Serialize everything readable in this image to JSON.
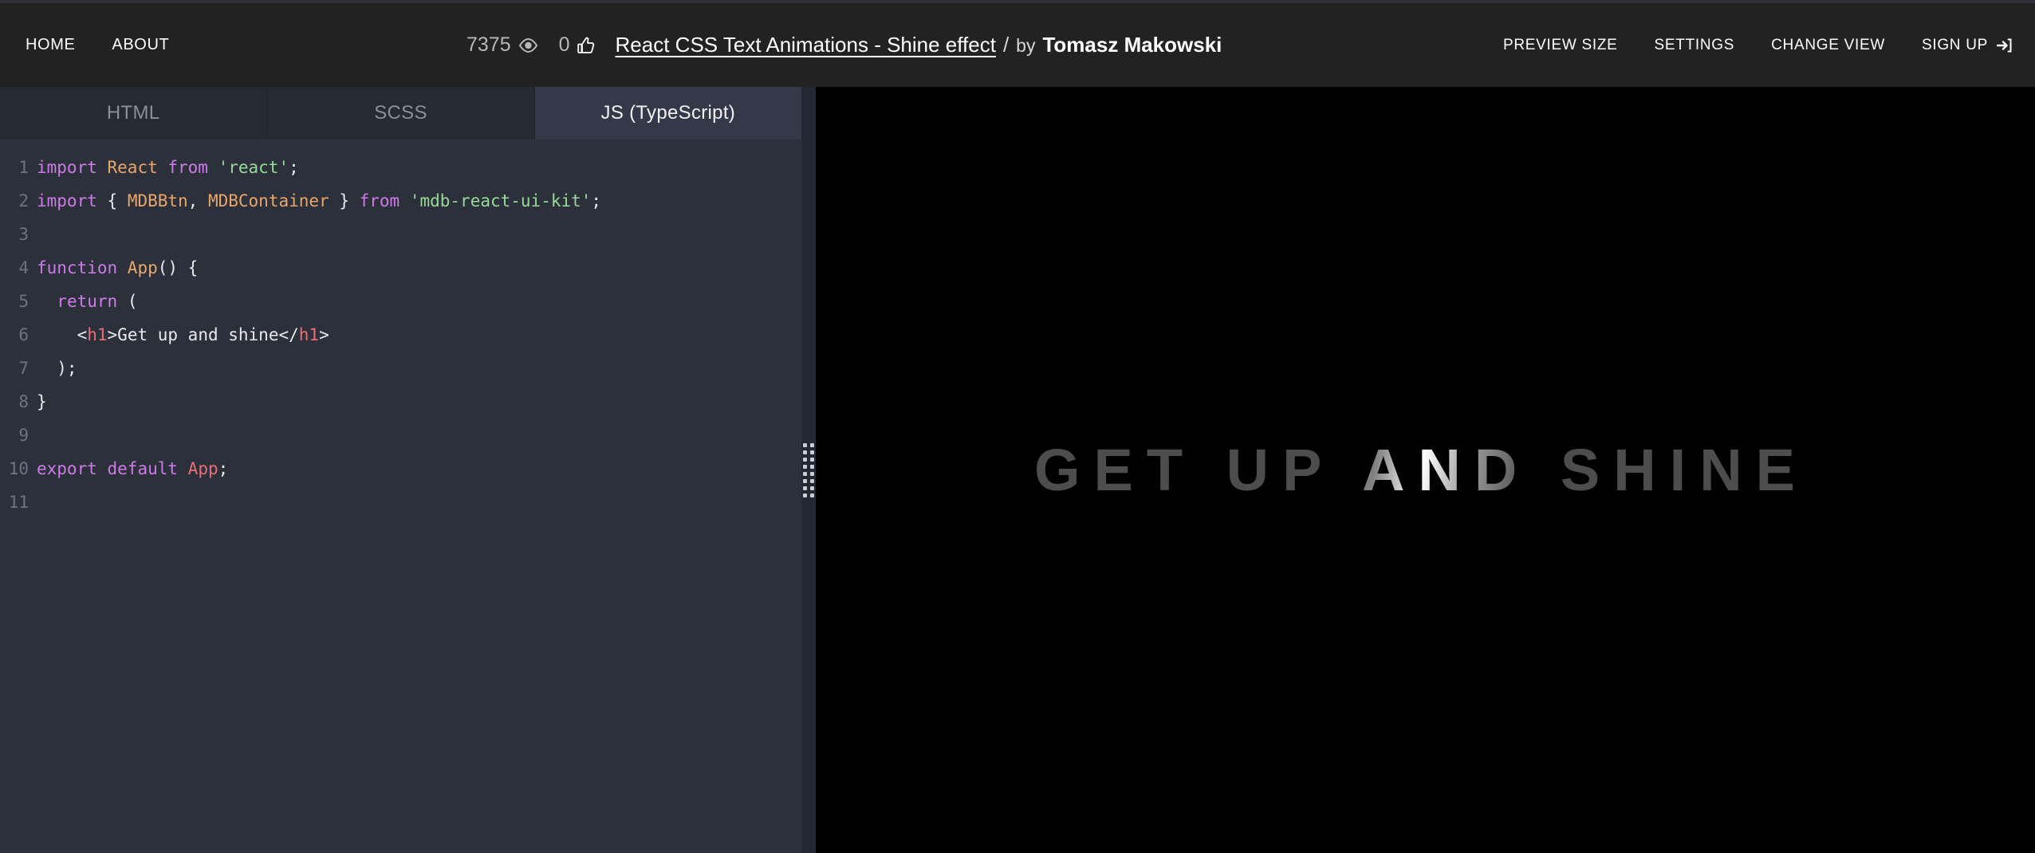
{
  "header": {
    "nav_left": [
      {
        "label": "HOME",
        "name": "nav-home"
      },
      {
        "label": "ABOUT",
        "name": "nav-about"
      }
    ],
    "stats": {
      "views_count": "7375",
      "views_icon": "eye-icon",
      "loves_count": "0",
      "loves_icon": "thumbs-up-icon"
    },
    "pen_title": "React CSS Text Animations - Shine effect",
    "separator": "/",
    "by_label": "by",
    "author": "Tomasz Makowski",
    "nav_right": [
      {
        "label": "PREVIEW SIZE",
        "name": "nav-preview-size"
      },
      {
        "label": "SETTINGS",
        "name": "nav-settings"
      },
      {
        "label": "CHANGE VIEW",
        "name": "nav-change-view"
      }
    ],
    "signup_label": "SIGN UP",
    "signup_icon": "sign-in-arrow-icon"
  },
  "editor": {
    "tabs": [
      {
        "label": "HTML",
        "active": false
      },
      {
        "label": "SCSS",
        "active": false
      },
      {
        "label": "JS (TypeScript)",
        "active": true
      }
    ],
    "lines": [
      {
        "num": "1",
        "tokens": [
          {
            "t": "import ",
            "c": "t-kw"
          },
          {
            "t": "React ",
            "c": "t-id"
          },
          {
            "t": "from ",
            "c": "t-kw"
          },
          {
            "t": "'react'",
            "c": "t-str"
          },
          {
            "t": ";",
            "c": "t-punc"
          }
        ]
      },
      {
        "num": "2",
        "tokens": [
          {
            "t": "import ",
            "c": "t-kw"
          },
          {
            "t": "{ ",
            "c": "t-punc"
          },
          {
            "t": "MDBBtn",
            "c": "t-id"
          },
          {
            "t": ", ",
            "c": "t-punc"
          },
          {
            "t": "MDBContainer",
            "c": "t-id"
          },
          {
            "t": " } ",
            "c": "t-punc"
          },
          {
            "t": "from ",
            "c": "t-kw"
          },
          {
            "t": "'mdb-react-ui-kit'",
            "c": "t-str"
          },
          {
            "t": ";",
            "c": "t-punc"
          }
        ]
      },
      {
        "num": "3",
        "tokens": []
      },
      {
        "num": "4",
        "tokens": [
          {
            "t": "function ",
            "c": "t-kw"
          },
          {
            "t": "App",
            "c": "t-id"
          },
          {
            "t": "() {",
            "c": "t-punc"
          }
        ]
      },
      {
        "num": "5",
        "tokens": [
          {
            "t": "  ",
            "c": "t-punc"
          },
          {
            "t": "return ",
            "c": "t-kw"
          },
          {
            "t": "(",
            "c": "t-punc"
          }
        ]
      },
      {
        "num": "6",
        "tokens": [
          {
            "t": "    <",
            "c": "t-punc"
          },
          {
            "t": "h1",
            "c": "t-tag"
          },
          {
            "t": ">",
            "c": "t-punc"
          },
          {
            "t": "Get up and shine",
            "c": "t-txt"
          },
          {
            "t": "</",
            "c": "t-punc"
          },
          {
            "t": "h1",
            "c": "t-tag"
          },
          {
            "t": ">",
            "c": "t-punc"
          }
        ]
      },
      {
        "num": "7",
        "tokens": [
          {
            "t": "  );",
            "c": "t-punc"
          }
        ]
      },
      {
        "num": "8",
        "tokens": [
          {
            "t": "}",
            "c": "t-punc"
          }
        ]
      },
      {
        "num": "9",
        "tokens": []
      },
      {
        "num": "10",
        "tokens": [
          {
            "t": "export ",
            "c": "t-kw"
          },
          {
            "t": "default ",
            "c": "t-kw"
          },
          {
            "t": "App",
            "c": "t-tag"
          },
          {
            "t": ";",
            "c": "t-punc"
          }
        ]
      },
      {
        "num": "11",
        "tokens": []
      }
    ],
    "drag_handle_dots": 16
  },
  "preview": {
    "text": "GET UP AND SHINE",
    "background": "#000000",
    "base_color": "#4d4d4d",
    "shine_color": "#ffffff"
  }
}
